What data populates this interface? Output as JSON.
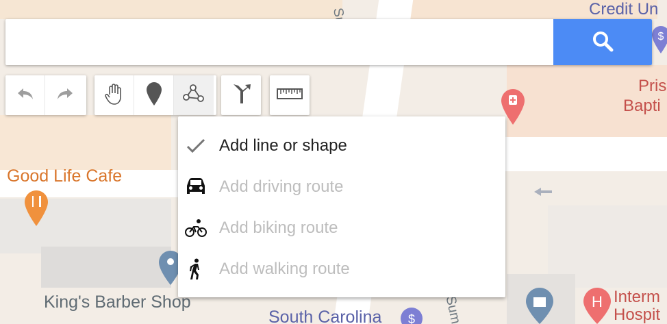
{
  "search": {
    "placeholder": "",
    "value": ""
  },
  "toolbar": {
    "undo_icon": "undo-icon",
    "redo_icon": "redo-icon",
    "pan_icon": "hand-icon",
    "marker_icon": "marker-icon",
    "draw_icon": "polyline-icon",
    "directions_icon": "directions-icon",
    "measure_icon": "ruler-icon"
  },
  "draw_menu": {
    "items": [
      {
        "label": "Add line or shape",
        "icon": "checkmark-icon",
        "enabled": true
      },
      {
        "label": "Add driving route",
        "icon": "car-icon",
        "enabled": false
      },
      {
        "label": "Add biking route",
        "icon": "bicycle-icon",
        "enabled": false
      },
      {
        "label": "Add walking route",
        "icon": "walker-icon",
        "enabled": false
      }
    ]
  },
  "map": {
    "labels": {
      "credit_union": "Credit Un",
      "prison_baptist_1": "Pris",
      "prison_baptist_2": "Bapti",
      "good_life_cafe": "Good Life Cafe",
      "kings_barber_shop": "King's Barber Shop",
      "south_carolina": "South Carolina",
      "hospital_1": "Interm",
      "hospital_2": "Hospit",
      "street_top": "Sum",
      "street_bottom": "Sum"
    }
  },
  "colors": {
    "search_button": "#4c8bf5",
    "cafe_label": "#d9762c",
    "place_label": "#5f6b73",
    "medical_label": "#c4504b",
    "credit_label": "#5a62a8"
  }
}
